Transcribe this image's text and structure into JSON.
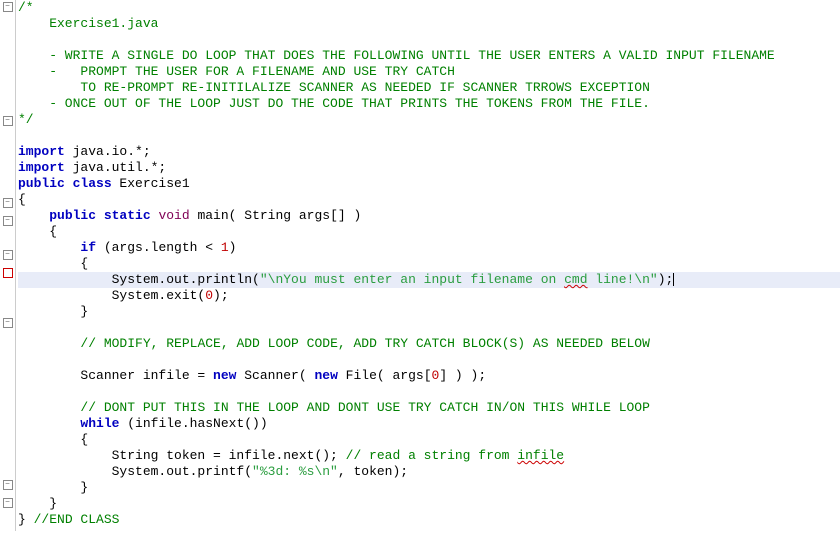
{
  "fold_markers": {
    "0": "-",
    "7": "-",
    "12": "-",
    "13": "-",
    "15": "-",
    "16": "mark",
    "19": "-",
    "29": "-",
    "30": "-"
  },
  "lines": [
    [
      [
        "c-comment",
        "/*"
      ]
    ],
    [
      [
        "c-comment",
        "    Exercise1.java"
      ]
    ],
    [
      [
        "c-comment",
        ""
      ]
    ],
    [
      [
        "c-comment",
        "    - WRITE A SINGLE DO LOOP THAT DOES THE FOLLOWING UNTIL THE USER ENTERS A VALID INPUT FILENAME"
      ]
    ],
    [
      [
        "c-comment",
        "    -   PROMPT THE USER FOR A FILENAME AND USE TRY CATCH"
      ]
    ],
    [
      [
        "c-comment",
        "        TO RE-PROMPT RE-INITILALIZE SCANNER AS NEEDED IF SCANNER TRROWS EXCEPTION"
      ]
    ],
    [
      [
        "c-comment",
        "    - ONCE OUT OF THE LOOP JUST DO THE CODE THAT PRINTS THE TOKENS FROM THE FILE."
      ]
    ],
    [
      [
        "c-comment",
        "*/"
      ]
    ],
    [
      [
        "",
        ""
      ]
    ],
    [
      [
        "c-keyword",
        "import "
      ],
      [
        "c-plain",
        "java.io.*;"
      ]
    ],
    [
      [
        "c-keyword",
        "import "
      ],
      [
        "c-plain",
        "java.util.*;"
      ]
    ],
    [
      [
        "c-keyword",
        "public class "
      ],
      [
        "c-plain",
        "Exercise1"
      ]
    ],
    [
      [
        "c-plain",
        "{"
      ]
    ],
    [
      [
        "c-plain",
        "    "
      ],
      [
        "c-keyword",
        "public static "
      ],
      [
        "c-mod",
        "void"
      ],
      [
        "c-plain",
        " main( String args[] )"
      ]
    ],
    [
      [
        "c-plain",
        "    {"
      ]
    ],
    [
      [
        "c-plain",
        "        "
      ],
      [
        "c-keyword",
        "if"
      ],
      [
        "c-plain",
        " (args.length < "
      ],
      [
        "c-num",
        "1"
      ],
      [
        "c-plain",
        ")"
      ]
    ],
    [
      [
        "c-plain",
        "        {"
      ]
    ],
    [
      [
        "c-plain",
        "            System.out.println("
      ],
      [
        "c-string",
        "\"\\nYou must enter an input filename on "
      ],
      [
        "c-string c-squiggle",
        "cmd"
      ],
      [
        "c-string",
        " line!\\n\""
      ],
      [
        "c-plain",
        ");"
      ],
      [
        "cursor",
        ""
      ]
    ],
    [
      [
        "c-plain",
        "            System.exit("
      ],
      [
        "c-num",
        "0"
      ],
      [
        "c-plain",
        ");"
      ]
    ],
    [
      [
        "c-plain",
        "        }"
      ]
    ],
    [
      [
        "",
        ""
      ]
    ],
    [
      [
        "c-plain",
        "        "
      ],
      [
        "c-comment",
        "// MODIFY, REPLACE, ADD LOOP CODE, ADD TRY CATCH BLOCK(S) AS NEEDED BELOW"
      ]
    ],
    [
      [
        "",
        ""
      ]
    ],
    [
      [
        "c-plain",
        "        Scanner infile = "
      ],
      [
        "c-keyword",
        "new"
      ],
      [
        "c-plain",
        " Scanner( "
      ],
      [
        "c-keyword",
        "new"
      ],
      [
        "c-plain",
        " File( args["
      ],
      [
        "c-num",
        "0"
      ],
      [
        "c-plain",
        "] ) );"
      ]
    ],
    [
      [
        "",
        ""
      ]
    ],
    [
      [
        "c-plain",
        "        "
      ],
      [
        "c-comment",
        "// DONT PUT THIS IN THE LOOP AND DONT USE TRY CATCH IN/ON THIS WHILE LOOP"
      ]
    ],
    [
      [
        "c-plain",
        "        "
      ],
      [
        "c-keyword",
        "while"
      ],
      [
        "c-plain",
        " (infile.hasNext())"
      ]
    ],
    [
      [
        "c-plain",
        "        {"
      ]
    ],
    [
      [
        "c-plain",
        "            String token = infile.next(); "
      ],
      [
        "c-comment",
        "// read a string from "
      ],
      [
        "c-comment c-squiggle",
        "infile"
      ]
    ],
    [
      [
        "c-plain",
        "            System.out.printf("
      ],
      [
        "c-string",
        "\"%3d: %s\\n\""
      ],
      [
        "c-plain",
        ", token);"
      ]
    ],
    [
      [
        "c-plain",
        "        }"
      ]
    ],
    [
      [
        "c-plain",
        "    }"
      ]
    ],
    [
      [
        "c-plain",
        "} "
      ],
      [
        "c-comment",
        "//END CLASS"
      ]
    ]
  ],
  "highlighted_line": 17
}
